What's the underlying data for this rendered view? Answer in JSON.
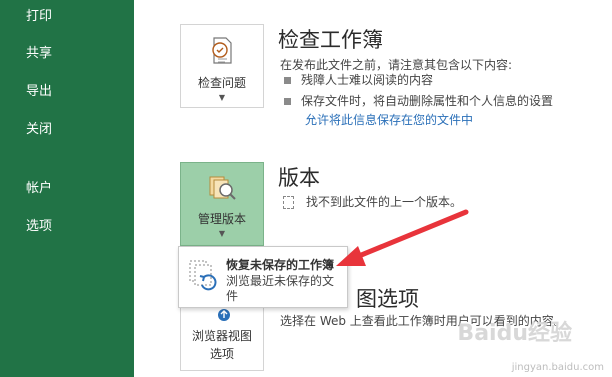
{
  "sidebar": {
    "items": [
      {
        "label": "打印"
      },
      {
        "label": "共享"
      },
      {
        "label": "导出"
      },
      {
        "label": "关闭"
      },
      {
        "label": "帐户"
      },
      {
        "label": "选项"
      }
    ]
  },
  "inspect": {
    "button_label": "检查问题",
    "title": "检查工作簿",
    "intro": "在发布此文件之前，请注意其包含以下内容:",
    "bullets": [
      "残障人士难以阅读的内容",
      "保存文件时，将自动删除属性和个人信息的设置"
    ],
    "link": "允许将此信息保存在您的文件中"
  },
  "versions": {
    "button_label": "管理版本",
    "title": "版本",
    "message": "找不到此文件的上一个版本。"
  },
  "dropdown": {
    "item_title": "恢复未保存的工作簿",
    "item_desc": "浏览最近未保存的文件"
  },
  "browser": {
    "button_label_1": "浏览器视图",
    "button_label_2": "选项",
    "title_partial": "图选项",
    "desc": "选择在 Web 上查看此工作簿时用户可以看到的内容。"
  },
  "watermark": {
    "text": "jingyan.baidu.com",
    "logo": "Baidu经验"
  },
  "colors": {
    "sidebar_bg": "#217346",
    "active_tile": "#9ccfa9",
    "link": "#2a6fb8",
    "annotation_arrow": "#e8343b"
  }
}
